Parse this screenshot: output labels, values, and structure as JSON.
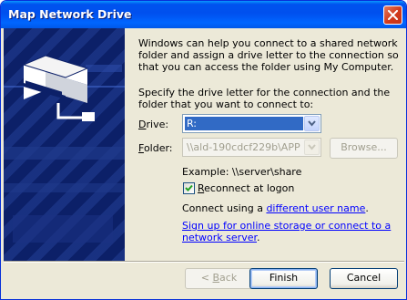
{
  "window": {
    "title": "Map Network Drive",
    "close_icon": "close-x-icon"
  },
  "intro_text": "Windows can help you connect to a shared network folder and assign a drive letter to the connection so that you can access the folder using My Computer.",
  "specify_text": "Specify the drive letter for the connection and the folder that you want to connect to:",
  "drive": {
    "label_accel": "D",
    "label_rest": "rive:",
    "value": "R:"
  },
  "folder": {
    "label_accel": "F",
    "label_rest": "older:",
    "value": "\\\\ald-190cdcf229b\\APP",
    "browse_label": "Browse..."
  },
  "example_text": "Example: \\\\server\\share",
  "reconnect": {
    "checked": true,
    "label_accel": "R",
    "label_rest": "econnect at logon"
  },
  "connect_using": {
    "prefix": "Connect using a ",
    "link": "different user name",
    "suffix": "."
  },
  "signup_link": "Sign up for online storage or connect to a network server",
  "signup_suffix": ".",
  "buttons": {
    "back_prefix": "< ",
    "back_accel": "B",
    "back_rest": "ack",
    "finish": "Finish",
    "cancel": "Cancel"
  },
  "colors": {
    "title_bar": "#0054e3",
    "side_panel": "#0c2068",
    "dialog_bg": "#ece9d8",
    "selection": "#316ac5",
    "link": "#0000ff"
  }
}
